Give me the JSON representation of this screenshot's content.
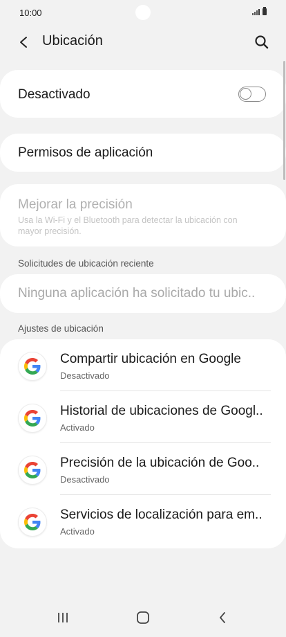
{
  "status_bar": {
    "time": "10:00"
  },
  "header": {
    "title": "Ubicación"
  },
  "location_toggle": {
    "label": "Desactivado",
    "enabled": false
  },
  "app_permissions": {
    "label": "Permisos de aplicación"
  },
  "improve_accuracy": {
    "title": "Mejorar la precisión",
    "description": "Usa la Wi-Fi y el Bluetooth para detectar la ubicación con mayor precisión."
  },
  "recent_requests": {
    "header": "Solicitudes de ubicación reciente",
    "empty_text": "Ninguna aplicación ha solicitado tu ubic.."
  },
  "location_settings": {
    "header": "Ajustes de ubicación",
    "items": [
      {
        "title": "Compartir ubicación en Google",
        "status": "Desactivado",
        "icon": "google-icon"
      },
      {
        "title": "Historial de ubicaciones de Googl..",
        "status": "Activado",
        "icon": "google-icon"
      },
      {
        "title": "Precisión de la ubicación de Goo..",
        "status": "Desactivado",
        "icon": "google-icon"
      },
      {
        "title": "Servicios de localización para em..",
        "status": "Activado",
        "icon": "google-icon"
      }
    ]
  },
  "colors": {
    "background": "#f2f2f2",
    "card": "#ffffff",
    "google_blue": "#4285F4",
    "google_red": "#EA4335",
    "google_yellow": "#FBBC05",
    "google_green": "#34A853"
  }
}
